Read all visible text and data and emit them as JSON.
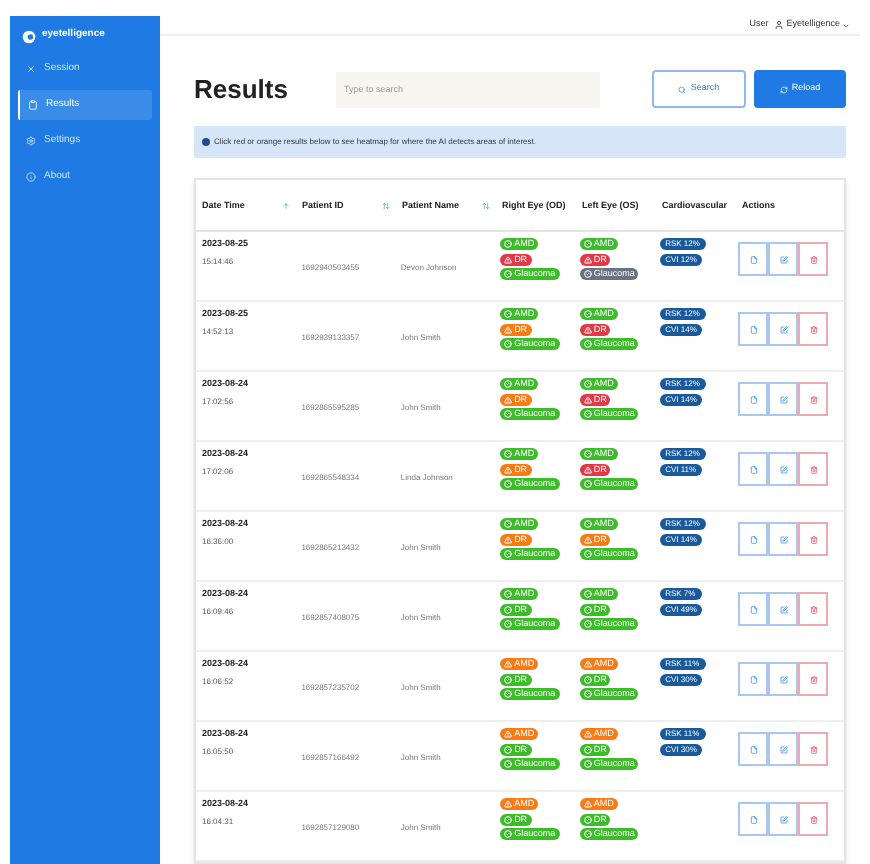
{
  "sidebar": {
    "logo": "eyetelligence",
    "items": [
      {
        "label": "Session",
        "selected": false
      },
      {
        "label": "Results",
        "selected": true
      },
      {
        "label": "Settings",
        "selected": false
      },
      {
        "label": "About",
        "selected": false
      }
    ]
  },
  "top_bar": {
    "role": "User",
    "account": "Eyetelligence"
  },
  "page_title": "Results",
  "search": {
    "placeholder": "Type to search"
  },
  "buttons": {
    "search": "Search",
    "reload": "Reload"
  },
  "info": "Click red or orange results below to see heatmap for where the AI detects areas of interest.",
  "table": {
    "columns": [
      {
        "label": "Date Time",
        "kind": "sorted"
      },
      {
        "label": "Patient ID",
        "kind": "sortable"
      },
      {
        "label": "Patient Name",
        "kind": "sortable"
      },
      {
        "label": "Right Eye (OD)",
        "kind": "plain"
      },
      {
        "label": "Left Eye (OS)",
        "kind": "plain"
      },
      {
        "label": "Cardiovascular",
        "kind": "plain"
      },
      {
        "label": "Actions",
        "kind": "plain"
      }
    ],
    "rows": [
      {
        "date": "2023-08-25",
        "time": "15:14:46",
        "patient_id": "1692940503455",
        "patient_name": "Devon Johnson",
        "right_eye": [
          {
            "label": "AMD",
            "kind": "ok",
            "color": "#3dbb2a"
          },
          {
            "label": "DR",
            "kind": "alert",
            "color": "#e33845"
          },
          {
            "label": "Glaucoma",
            "kind": "ok",
            "color": "#3dbb2a"
          }
        ],
        "left_eye": [
          {
            "label": "AMD",
            "kind": "ok",
            "color": "#3dbb2a"
          },
          {
            "label": "DR",
            "kind": "alert",
            "color": "#e33845"
          },
          {
            "label": "Glaucoma",
            "kind": "ok",
            "color": "#6b7280"
          }
        ],
        "cardio": [
          "RSK 12%",
          "CVI 12%"
        ]
      },
      {
        "date": "2023-08-25",
        "time": "14:52:13",
        "patient_id": "1692939133357",
        "patient_name": "John Smith",
        "right_eye": [
          {
            "label": "AMD",
            "kind": "ok",
            "color": "#3dbb2a"
          },
          {
            "label": "DR",
            "kind": "alert",
            "color": "#f97b16"
          },
          {
            "label": "Glaucoma",
            "kind": "ok",
            "color": "#3dbb2a"
          }
        ],
        "left_eye": [
          {
            "label": "AMD",
            "kind": "ok",
            "color": "#3dbb2a"
          },
          {
            "label": "DR",
            "kind": "alert",
            "color": "#e33845"
          },
          {
            "label": "Glaucoma",
            "kind": "ok",
            "color": "#3dbb2a"
          }
        ],
        "cardio": [
          "RSK 12%",
          "CVI 14%"
        ]
      },
      {
        "date": "2023-08-24",
        "time": "17:02:56",
        "patient_id": "1692865595285",
        "patient_name": "John Smith",
        "right_eye": [
          {
            "label": "AMD",
            "kind": "ok",
            "color": "#3dbb2a"
          },
          {
            "label": "DR",
            "kind": "alert",
            "color": "#f97b16"
          },
          {
            "label": "Glaucoma",
            "kind": "ok",
            "color": "#3dbb2a"
          }
        ],
        "left_eye": [
          {
            "label": "AMD",
            "kind": "ok",
            "color": "#3dbb2a"
          },
          {
            "label": "DR",
            "kind": "alert",
            "color": "#e33845"
          },
          {
            "label": "Glaucoma",
            "kind": "ok",
            "color": "#3dbb2a"
          }
        ],
        "cardio": [
          "RSK 12%",
          "CVI 14%"
        ]
      },
      {
        "date": "2023-08-24",
        "time": "17:02:06",
        "patient_id": "1692865548334",
        "patient_name": "Linda Johnson",
        "right_eye": [
          {
            "label": "AMD",
            "kind": "ok",
            "color": "#3dbb2a"
          },
          {
            "label": "DR",
            "kind": "alert",
            "color": "#f97b16"
          },
          {
            "label": "Glaucoma",
            "kind": "ok",
            "color": "#3dbb2a"
          }
        ],
        "left_eye": [
          {
            "label": "AMD",
            "kind": "ok",
            "color": "#3dbb2a"
          },
          {
            "label": "DR",
            "kind": "alert",
            "color": "#e33845"
          },
          {
            "label": "Glaucoma",
            "kind": "ok",
            "color": "#3dbb2a"
          }
        ],
        "cardio": [
          "RSK 12%",
          "CVI 11%"
        ]
      },
      {
        "date": "2023-08-24",
        "time": "16:36:00",
        "patient_id": "1692865213432",
        "patient_name": "John Smith",
        "right_eye": [
          {
            "label": "AMD",
            "kind": "ok",
            "color": "#3dbb2a"
          },
          {
            "label": "DR",
            "kind": "alert",
            "color": "#f97b16"
          },
          {
            "label": "Glaucoma",
            "kind": "ok",
            "color": "#3dbb2a"
          }
        ],
        "left_eye": [
          {
            "label": "AMD",
            "kind": "ok",
            "color": "#3dbb2a"
          },
          {
            "label": "DR",
            "kind": "alert",
            "color": "#f97b16"
          },
          {
            "label": "Glaucoma",
            "kind": "ok",
            "color": "#3dbb2a"
          }
        ],
        "cardio": [
          "RSK 12%",
          "CVI 14%"
        ]
      },
      {
        "date": "2023-08-24",
        "time": "16:09:46",
        "patient_id": "1692857408075",
        "patient_name": "John Smith",
        "right_eye": [
          {
            "label": "AMD",
            "kind": "ok",
            "color": "#3dbb2a"
          },
          {
            "label": "DR",
            "kind": "ok",
            "color": "#3dbb2a"
          },
          {
            "label": "Glaucoma",
            "kind": "ok",
            "color": "#3dbb2a"
          }
        ],
        "left_eye": [
          {
            "label": "AMD",
            "kind": "ok",
            "color": "#3dbb2a"
          },
          {
            "label": "DR",
            "kind": "ok",
            "color": "#3dbb2a"
          },
          {
            "label": "Glaucoma",
            "kind": "ok",
            "color": "#3dbb2a"
          }
        ],
        "cardio": [
          "RSK 7%",
          "CVI 49%"
        ]
      },
      {
        "date": "2023-08-24",
        "time": "16:06:52",
        "patient_id": "1692857235702",
        "patient_name": "John Smith",
        "right_eye": [
          {
            "label": "AMD",
            "kind": "alert",
            "color": "#f97b16"
          },
          {
            "label": "DR",
            "kind": "ok",
            "color": "#3dbb2a"
          },
          {
            "label": "Glaucoma",
            "kind": "ok",
            "color": "#3dbb2a"
          }
        ],
        "left_eye": [
          {
            "label": "AMD",
            "kind": "alert",
            "color": "#f97b16"
          },
          {
            "label": "DR",
            "kind": "ok",
            "color": "#3dbb2a"
          },
          {
            "label": "Glaucoma",
            "kind": "ok",
            "color": "#3dbb2a"
          }
        ],
        "cardio": [
          "RSK 11%",
          "CVI 30%"
        ]
      },
      {
        "date": "2023-08-24",
        "time": "16:05:50",
        "patient_id": "1692857166492",
        "patient_name": "John Smith",
        "right_eye": [
          {
            "label": "AMD",
            "kind": "alert",
            "color": "#f97b16"
          },
          {
            "label": "DR",
            "kind": "ok",
            "color": "#3dbb2a"
          },
          {
            "label": "Glaucoma",
            "kind": "ok",
            "color": "#3dbb2a"
          }
        ],
        "left_eye": [
          {
            "label": "AMD",
            "kind": "alert",
            "color": "#f97b16"
          },
          {
            "label": "DR",
            "kind": "ok",
            "color": "#3dbb2a"
          },
          {
            "label": "Glaucoma",
            "kind": "ok",
            "color": "#3dbb2a"
          }
        ],
        "cardio": [
          "RSK 11%",
          "CVI 30%"
        ]
      },
      {
        "date": "2023-08-24",
        "time": "16:04:31",
        "patient_id": "1692857129080",
        "patient_name": "John Smith",
        "right_eye": [
          {
            "label": "AMD",
            "kind": "alert",
            "color": "#f97b16"
          },
          {
            "label": "DR",
            "kind": "ok",
            "color": "#3dbb2a"
          },
          {
            "label": "Glaucoma",
            "kind": "ok",
            "color": "#3dbb2a"
          }
        ],
        "left_eye": [
          {
            "label": "AMD",
            "kind": "alert",
            "color": "#f97b16"
          },
          {
            "label": "DR",
            "kind": "ok",
            "color": "#3dbb2a"
          },
          {
            "label": "Glaucoma",
            "kind": "ok",
            "color": "#3dbb2a"
          }
        ],
        "cardio": []
      }
    ]
  }
}
